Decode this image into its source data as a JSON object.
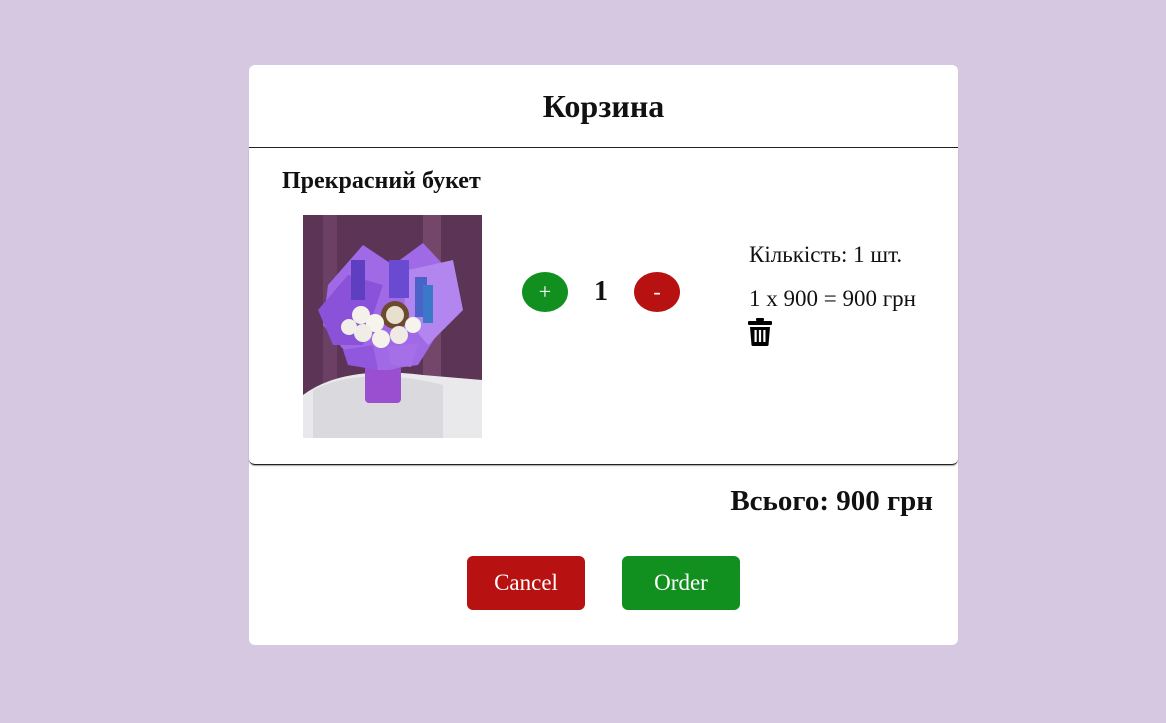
{
  "cart": {
    "title": "Корзина",
    "item": {
      "name": "Прекрасний букет",
      "image_alt": "flower-bouquet-photo",
      "quantity": "1",
      "plus_label": "+",
      "minus_label": "-",
      "quantity_text": "Кількість: 1 шт.",
      "price_text": "1 x 900 = 900 грн",
      "delete_icon": "trash-icon"
    },
    "total_text": "Всього: 900 грн",
    "buttons": {
      "cancel": "Cancel",
      "order": "Order"
    }
  },
  "colors": {
    "background": "#d7c8e1",
    "green": "#12901f",
    "red": "#b81111"
  }
}
